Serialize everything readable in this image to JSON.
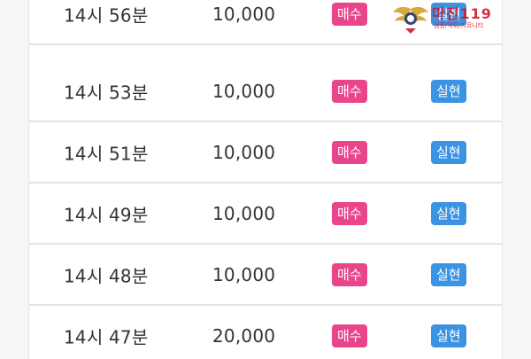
{
  "rows": [
    {
      "time": "14시 56분",
      "amount": "10,000",
      "type": "매수",
      "status": "실현"
    },
    {
      "time": "14시 53분",
      "amount": "10,000",
      "type": "매수",
      "status": "실현"
    },
    {
      "time": "14시 51분",
      "amount": "10,000",
      "type": "매수",
      "status": "실현"
    },
    {
      "time": "14시 49분",
      "amount": "10,000",
      "type": "매수",
      "status": "실현"
    },
    {
      "time": "14시 48분",
      "amount": "10,000",
      "type": "매수",
      "status": "실현"
    },
    {
      "time": "14시 47분",
      "amount": "20,000",
      "type": "매수",
      "status": "실현"
    }
  ],
  "watermark": {
    "title": "마진119",
    "subtitle": "검증/먹튀/커뮤니티",
    "icon": "wings-logo-icon"
  },
  "colors": {
    "buy_badge": "#e8458b",
    "realized_badge": "#3b93e3",
    "watermark": "#d21a2a"
  }
}
